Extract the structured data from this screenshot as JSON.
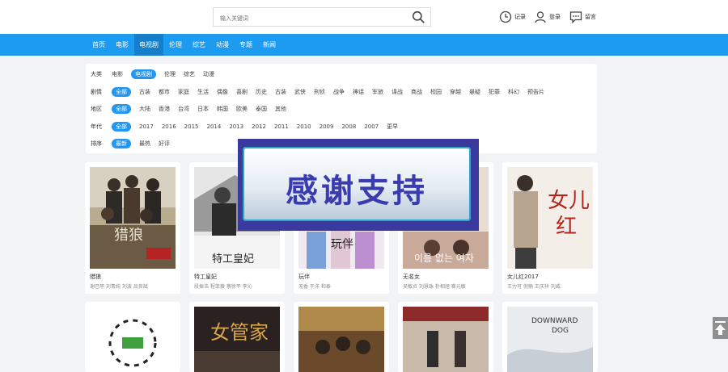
{
  "header": {
    "search_placeholder": "输入关键词",
    "tools": [
      {
        "icon": "clock-icon",
        "label": "记录"
      },
      {
        "icon": "user-icon",
        "label": "登录"
      },
      {
        "icon": "message-icon",
        "label": "留言"
      }
    ]
  },
  "nav": {
    "items": [
      "首页",
      "电影",
      "电视剧",
      "伦理",
      "综艺",
      "动漫",
      "专题",
      "新闻"
    ],
    "active": "电视剧"
  },
  "filter": {
    "rows": [
      {
        "label": "大类",
        "options": [
          "电影",
          "电视剧",
          "伦理",
          "综艺",
          "动漫"
        ],
        "selected": "电视剧"
      },
      {
        "label": "剧情",
        "options": [
          "全部",
          "古装",
          "都市",
          "家庭",
          "生活",
          "偶像",
          "喜剧",
          "历史",
          "古装",
          "武侠",
          "刑侦",
          "战争",
          "神话",
          "军旅",
          "谍战",
          "商战",
          "校园",
          "穿越",
          "悬疑",
          "犯罪",
          "科幻",
          "预告片"
        ],
        "selected": "全部"
      },
      {
        "label": "地区",
        "options": [
          "全部",
          "大陆",
          "香港",
          "台湾",
          "日本",
          "韩国",
          "欧美",
          "泰国",
          "其他"
        ],
        "selected": "全部"
      },
      {
        "label": "年代",
        "options": [
          "全部",
          "2017",
          "2016",
          "2015",
          "2014",
          "2013",
          "2012",
          "2011",
          "2010",
          "2009",
          "2008",
          "2007",
          "更早"
        ],
        "selected": "全部"
      },
      {
        "label": "排序",
        "options": [
          "最新",
          "最热",
          "好评"
        ],
        "selected": "最新"
      }
    ]
  },
  "cards": [
    {
      "title": "猎狼",
      "cast": "谢巴甲 刘青纯 刘波 吕良斌"
    },
    {
      "title": "特工皇妃",
      "cast": "段振浩 程菲薇 蔡徐平 李沁"
    },
    {
      "title": "",
      "cast": ""
    },
    {
      "title": "玩伴",
      "cast": "无香 于洋 和泰"
    },
    {
      "title": "无名女",
      "cast": "吴敏贞 刘慧珠 朴相旭 崔元敏"
    },
    {
      "title": "女儿红2017",
      "cast": "王力可 倪楠 王庆祥 刘威"
    }
  ],
  "watermark": {
    "text": "感谢支持"
  },
  "colors": {
    "nav": "#1d9bf0",
    "nav_active": "#1580c9",
    "selected": "#2196f3",
    "watermark_border": "#3a3a9e",
    "watermark_text": "#3b3bb0"
  }
}
